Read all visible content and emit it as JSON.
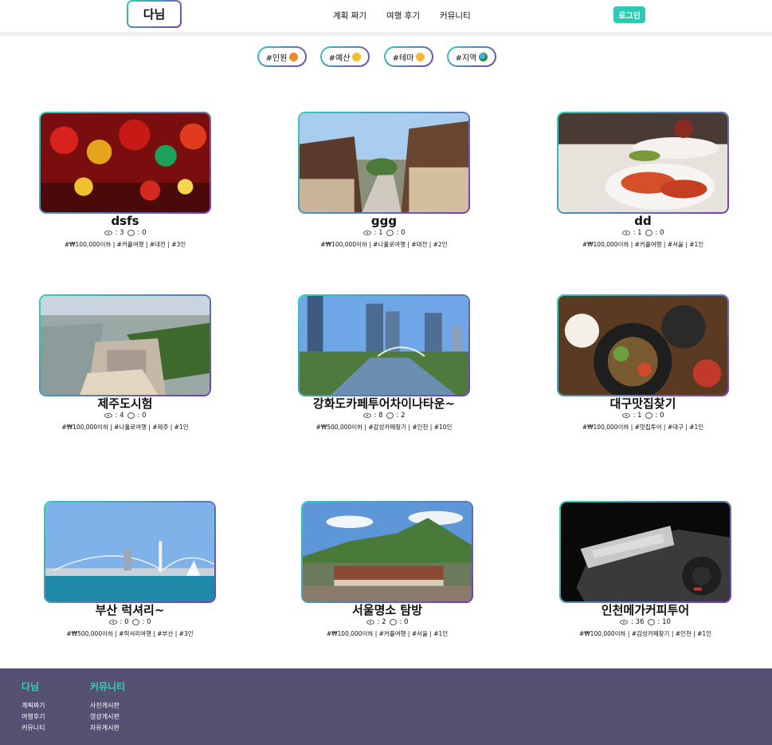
{
  "header": {
    "logo": "다님",
    "nav": [
      "계획 짜기",
      "여행 후기",
      "커뮤니티"
    ],
    "login_label": "로그인"
  },
  "filters": [
    {
      "label": "#인원",
      "icon": "person-icon"
    },
    {
      "label": "#예산",
      "icon": "money-bag-icon"
    },
    {
      "label": "#테마",
      "icon": "speech-bubble-icon"
    },
    {
      "label": "#지역",
      "icon": "globe-icon"
    }
  ],
  "cards": [
    {
      "title": "dsfs",
      "views": ": 3",
      "comments": ": 0",
      "tags": "#₩100,000이하 | #커플여행 | #대전 | #3인",
      "image": "lantern-market-photo"
    },
    {
      "title": "ggg",
      "views": ": 1",
      "comments": ": 0",
      "tags": "#₩100,000이하 | #나홀로여행 | #대전 | #2인",
      "image": "hanok-village-photo"
    },
    {
      "title": "dd",
      "views": ": 1",
      "comments": ": 0",
      "tags": "#₩100,000이하 | #커플여행 | #서울 | #1인",
      "image": "lobster-dinner-photo"
    },
    {
      "title": "제주도시험",
      "views": ": 4",
      "comments": ": 0",
      "tags": "#₩100,000이하 | #나홀로여행 | #제주 | #1인",
      "image": "coastal-city-aerial-photo"
    },
    {
      "title": "강화도카페투어차이나타운~",
      "views": ": 8",
      "comments": ": 2",
      "tags": "#₩500,000이하 | #감성카페찾기 | #인천 | #10인",
      "image": "city-canal-photo"
    },
    {
      "title": "대구맛집찾기",
      "views": ": 1",
      "comments": ": 0",
      "tags": "#₩100,000이하 | #맛집투어 | #대구 | #1인",
      "image": "food-platter-photo"
    },
    {
      "title": "부산 럭셔리~",
      "views": ": 0",
      "comments": ": 0",
      "tags": "#₩500,000이하 | #럭셔리여행 | #부산 | #3인",
      "image": "suspension-bridge-photo"
    },
    {
      "title": "서울명소 탐방",
      "views": ": 2",
      "comments": ": 0",
      "tags": "#₩100,000이하 | #커플여행 | #서울 | #1인",
      "image": "palace-mountain-photo"
    },
    {
      "title": "인천메가커피투어",
      "views": ": 36",
      "comments": ": 10",
      "tags": "#₩100,000이하 | #감성카페찾기 | #인천 | #1인",
      "image": "sony-camera-photo"
    }
  ],
  "footer": {
    "col1_head": "다님",
    "col1_links": [
      "계획짜기",
      "여행후기",
      "커뮤니티"
    ],
    "col2_head": "커뮤니티",
    "col2_links": [
      "사진게시판",
      "영상게시판",
      "자유게시판"
    ]
  },
  "colors": {
    "accent_teal": "#2ec9b2",
    "accent_purple": "#7a3bb5",
    "footer_bg": "#545172"
  }
}
